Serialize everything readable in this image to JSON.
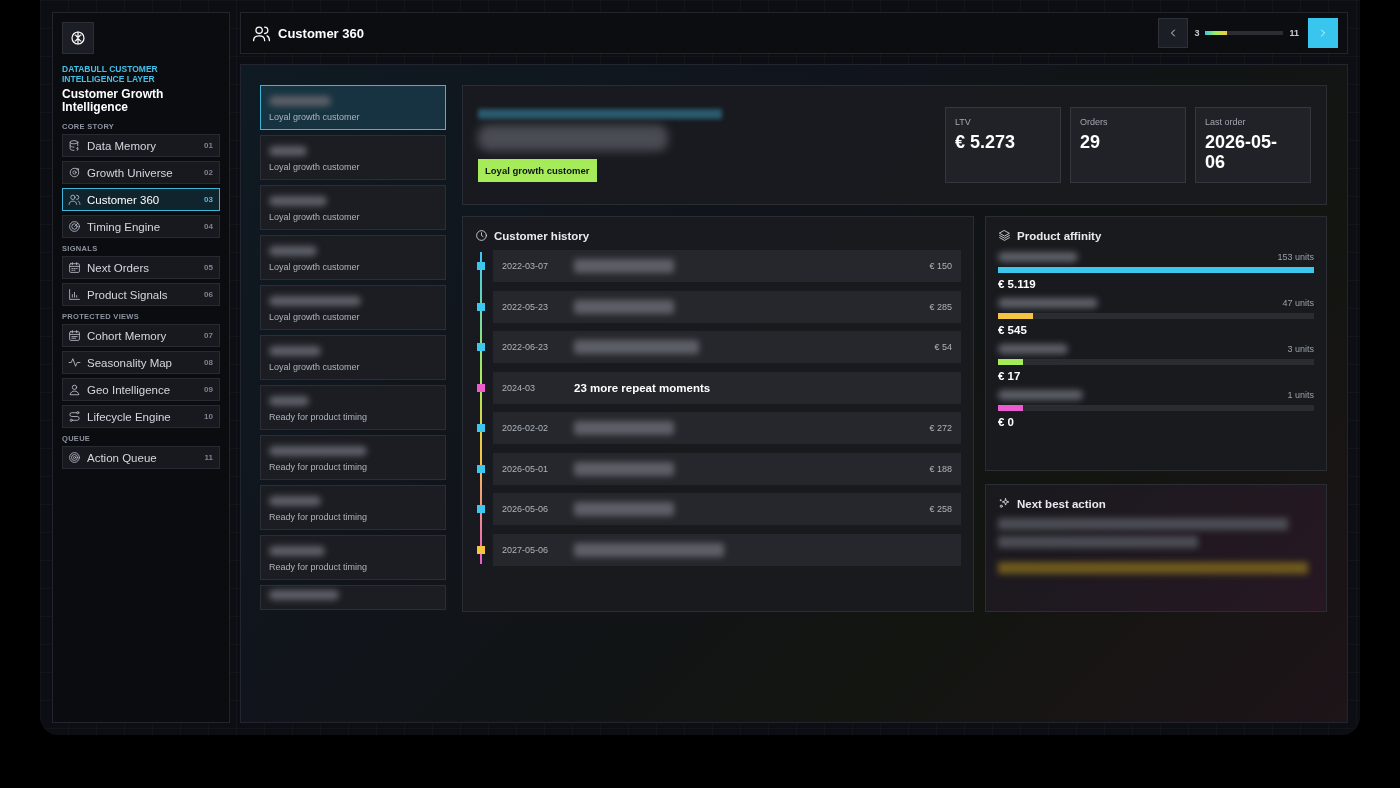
{
  "sidebar": {
    "eyebrow": "DATABULL CUSTOMER INTELLIGENCE LAYER",
    "title": "Customer Growth Intelligence",
    "sections": [
      {
        "label": "CORE STORY",
        "items": [
          {
            "label": "Data Memory",
            "number": "01",
            "selected": false
          },
          {
            "label": "Growth Universe",
            "number": "02",
            "selected": false
          },
          {
            "label": "Customer 360",
            "number": "03",
            "selected": true
          },
          {
            "label": "Timing Engine",
            "number": "04",
            "selected": false
          }
        ]
      },
      {
        "label": "SIGNALS",
        "items": [
          {
            "label": "Next Orders",
            "number": "05",
            "selected": false
          },
          {
            "label": "Product Signals",
            "number": "06",
            "selected": false
          }
        ]
      },
      {
        "label": "PROTECTED VIEWS",
        "items": [
          {
            "label": "Cohort Memory",
            "number": "07",
            "selected": false
          },
          {
            "label": "Seasonality Map",
            "number": "08",
            "selected": false
          },
          {
            "label": "Geo Intelligence",
            "number": "09",
            "selected": false
          },
          {
            "label": "Lifecycle Engine",
            "number": "10",
            "selected": false
          }
        ]
      },
      {
        "label": "QUEUE",
        "items": [
          {
            "label": "Action Queue",
            "number": "11",
            "selected": false
          }
        ]
      }
    ]
  },
  "header": {
    "title": "Customer 360",
    "pager": {
      "current": "3",
      "total": "11",
      "level": 0.27
    }
  },
  "customers": [
    {
      "segment": "Loyal growth customer",
      "selected": true
    },
    {
      "segment": "Loyal growth customer",
      "selected": false
    },
    {
      "segment": "Loyal growth customer",
      "selected": false
    },
    {
      "segment": "Loyal growth customer",
      "selected": false
    },
    {
      "segment": "Loyal growth customer",
      "selected": false
    },
    {
      "segment": "Loyal growth customer",
      "selected": false
    },
    {
      "segment": "Ready for product timing",
      "selected": false
    },
    {
      "segment": "Ready for product timing",
      "selected": false
    },
    {
      "segment": "Ready for product timing",
      "selected": false
    },
    {
      "segment": "Ready for product timing",
      "selected": false
    },
    {
      "selected": false
    }
  ],
  "profile": {
    "badge": "Loyal growth customer",
    "stats": [
      {
        "label": "LTV",
        "value": "€ 5.273"
      },
      {
        "label": "Orders",
        "value": "29"
      },
      {
        "label": "Last order",
        "value": "2026-05-06"
      }
    ]
  },
  "history": {
    "title": "Customer history",
    "events": [
      {
        "date": "2022-03-07",
        "amount": "€ 150",
        "color": "#3cc8ee"
      },
      {
        "date": "2022-05-23",
        "amount": "€ 285",
        "color": "#3cc8ee"
      },
      {
        "date": "2022-06-23",
        "amount": "€ 54",
        "color": "#3cc8ee"
      },
      {
        "date": "2024-03",
        "summary": "23 more repeat moments",
        "color": "#ec5ccf"
      },
      {
        "date": "2026-02-02",
        "amount": "€ 272",
        "color": "#3cc8ee"
      },
      {
        "date": "2026-05-01",
        "amount": "€ 188",
        "color": "#3cc8ee"
      },
      {
        "date": "2026-05-06",
        "amount": "€ 258",
        "color": "#3cc8ee"
      },
      {
        "date": "2027-05-06",
        "color": "#f5c542"
      }
    ]
  },
  "affinity": {
    "title": "Product affinity",
    "products": [
      {
        "units": "153 units",
        "value": "€ 5.119",
        "level": 1.0,
        "color": "#3cc8ee"
      },
      {
        "units": "47 units",
        "value": "€ 545",
        "level": 0.11,
        "color": "#f5c542"
      },
      {
        "units": "3 units",
        "value": "€ 17",
        "level": 0.08,
        "color": "#a6ec5a"
      },
      {
        "units": "1 units",
        "value": "€ 0",
        "level": 0.08,
        "color": "#ec5ccf"
      }
    ]
  },
  "next_action": {
    "title": "Next best action"
  }
}
